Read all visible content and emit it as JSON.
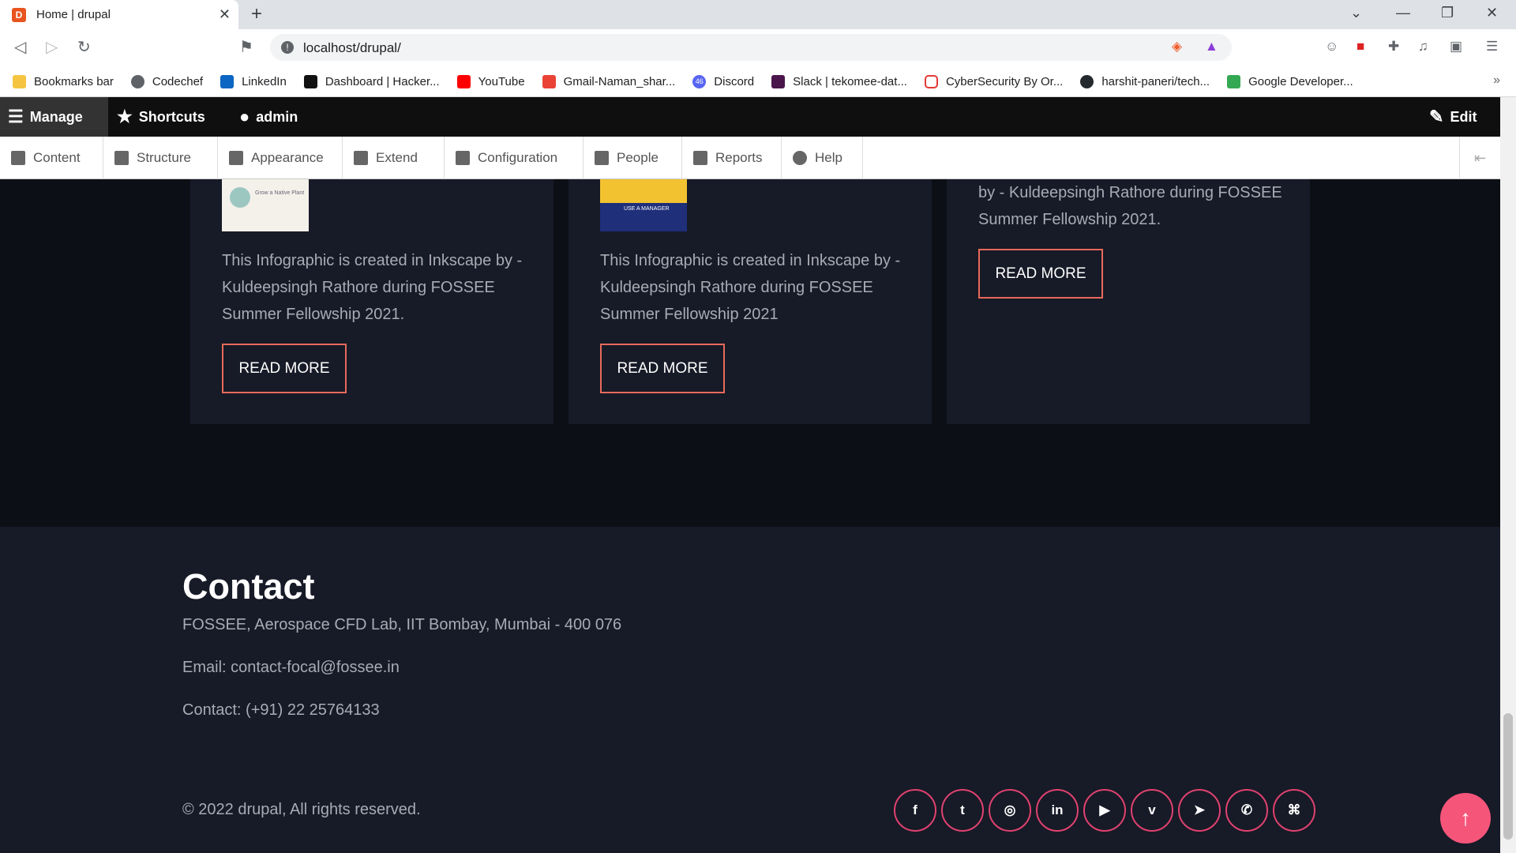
{
  "browser": {
    "tab_title": "Home | drupal",
    "favicon_text": "D",
    "url": "localhost/drupal/",
    "bookmarks": [
      "Bookmarks bar",
      "Codechef",
      "LinkedIn",
      "Dashboard | Hacker...",
      "YouTube",
      "Gmail-Naman_shar...",
      "Discord",
      "Slack | tekomee-dat...",
      "CyberSecurity By Or...",
      "harshit-paneri/tech...",
      "Google Developer..."
    ],
    "discord_badge": "46"
  },
  "admin_toolbar": {
    "manage": "Manage",
    "shortcuts": "Shortcuts",
    "user": "admin",
    "edit": "Edit",
    "tray": [
      "Content",
      "Structure",
      "Appearance",
      "Extend",
      "Configuration",
      "People",
      "Reports",
      "Help"
    ]
  },
  "cards": [
    {
      "text": "This Infographic is created in Inkscape by - Kuldeepsingh Rathore during FOSSEE Summer Fellowship 2021.",
      "button": "READ MORE",
      "thumb_caption": "Grow a Native Plant"
    },
    {
      "text": "This Infographic is created in Inkscape by - Kuldeepsingh Rathore during FOSSEE Summer Fellowship 2021",
      "button": "READ MORE",
      "thumb_caption": "USE A MANAGER"
    },
    {
      "text": "by - Kuldeepsingh Rathore during FOSSEE Summer Fellowship 2021.",
      "button": "READ MORE"
    }
  ],
  "footer": {
    "title": "Contact",
    "address": "FOSSEE, Aerospace CFD Lab, IIT Bombay, Mumbai - 400 076",
    "email": "Email: contact-focal@fossee.in",
    "phone": "Contact: (+91) 22 25764133",
    "copyright": "© 2022 drupal, All rights reserved.",
    "social": [
      "f",
      "t",
      "◎",
      "in",
      "▶",
      "v",
      "➤",
      "✆",
      "⌘"
    ],
    "totop": "↑"
  }
}
